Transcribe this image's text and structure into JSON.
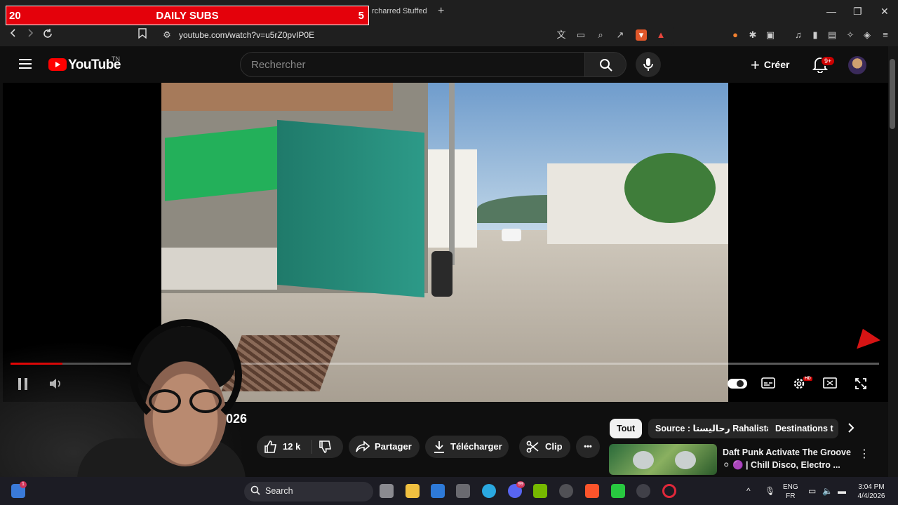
{
  "overlay": {
    "left_count": "20",
    "title": "DAILY SUBS",
    "right_count": "5"
  },
  "browser": {
    "tab_title": "rcharred Stuffed P",
    "tab_close": "×",
    "new_tab": "+",
    "url": "youtube.com/watch?v=u5rZ0pvIP0E",
    "window_controls": [
      "—",
      "❐",
      "✕"
    ]
  },
  "youtube": {
    "logo_text": "YouTube",
    "country_code": "TN",
    "search_placeholder": "Rechercher",
    "create_label": "Créer",
    "notifications_badge": "9+"
  },
  "player": {
    "progress_fraction": 0.06,
    "hd_badge": "HD"
  },
  "video": {
    "title_visible": "2026",
    "like_count": "12 k",
    "share_label": "Partager",
    "download_label": "Télécharger",
    "clip_label": "Clip",
    "more_label": "•••"
  },
  "sidebar": {
    "chips": [
      "Tout",
      "Source : رحاليستا Rahalista",
      "Destinations t"
    ],
    "recommendation": {
      "title": "Daft Punk Activate The Groove ⚪ 🟣 | Chill Disco, Electro ..."
    }
  },
  "taskbar": {
    "search_label": "Search",
    "start_badge": "1",
    "discord_badge": "99",
    "language_line1": "ENG",
    "language_line2": "FR",
    "time": "3:04 PM",
    "date": "4/4/2026"
  },
  "colors": {
    "accent_red": "#ff0000",
    "overlay_red": "#e4010b",
    "background": "#0f0f0f"
  }
}
